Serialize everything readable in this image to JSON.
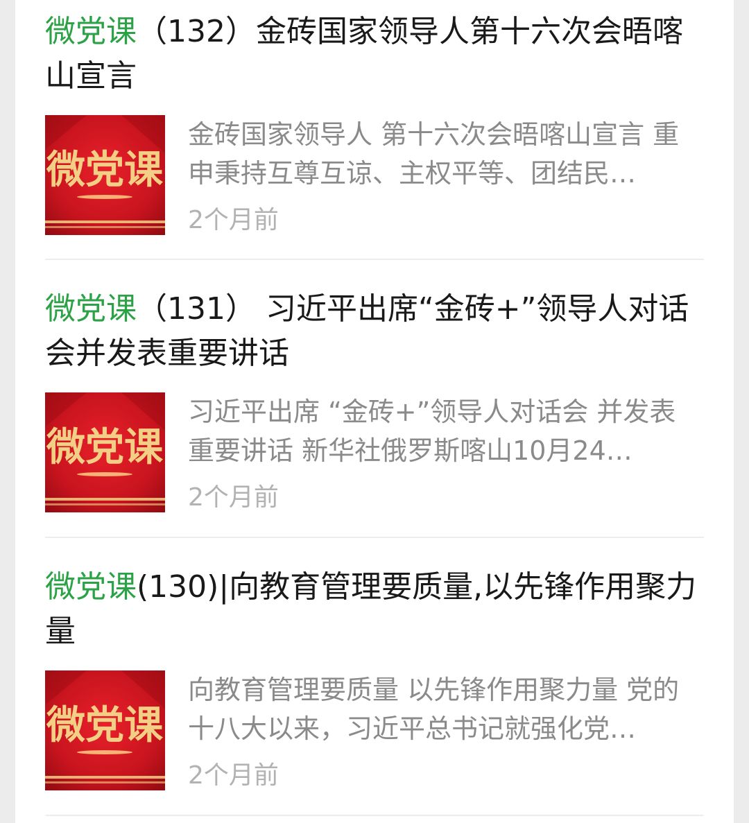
{
  "colors": {
    "keyword_green": "#2ba245",
    "thumb_red": "#c8141e",
    "thumb_gold": "#f3cf85"
  },
  "articles": [
    {
      "title_prefix": "微党课",
      "title_rest": "（132）金砖国家领导人第十六次会晤喀山宣言",
      "summary": "金砖国家领导人 第十六次会晤喀山宣言 重申秉持互尊互谅、主权平等、团结民…",
      "time": "2个月前",
      "thumb_text": "微党课"
    },
    {
      "title_prefix": "微党课",
      "title_rest": "（131） 习近平出席“金砖+”领导人对话会并发表重要讲话",
      "summary": "习近平出席 “金砖+”领导人对话会 并发表重要讲话 新华社俄罗斯喀山10月24…",
      "time": "2个月前",
      "thumb_text": "微党课"
    },
    {
      "title_prefix": "微党课",
      "title_rest": "(130)|向教育管理要质量,以先锋作用聚力量",
      "summary": "向教育管理要质量 以先锋作用聚力量 党的十八大以来，习近平总书记就强化党…",
      "time": "2个月前",
      "thumb_text": "微党课"
    }
  ]
}
